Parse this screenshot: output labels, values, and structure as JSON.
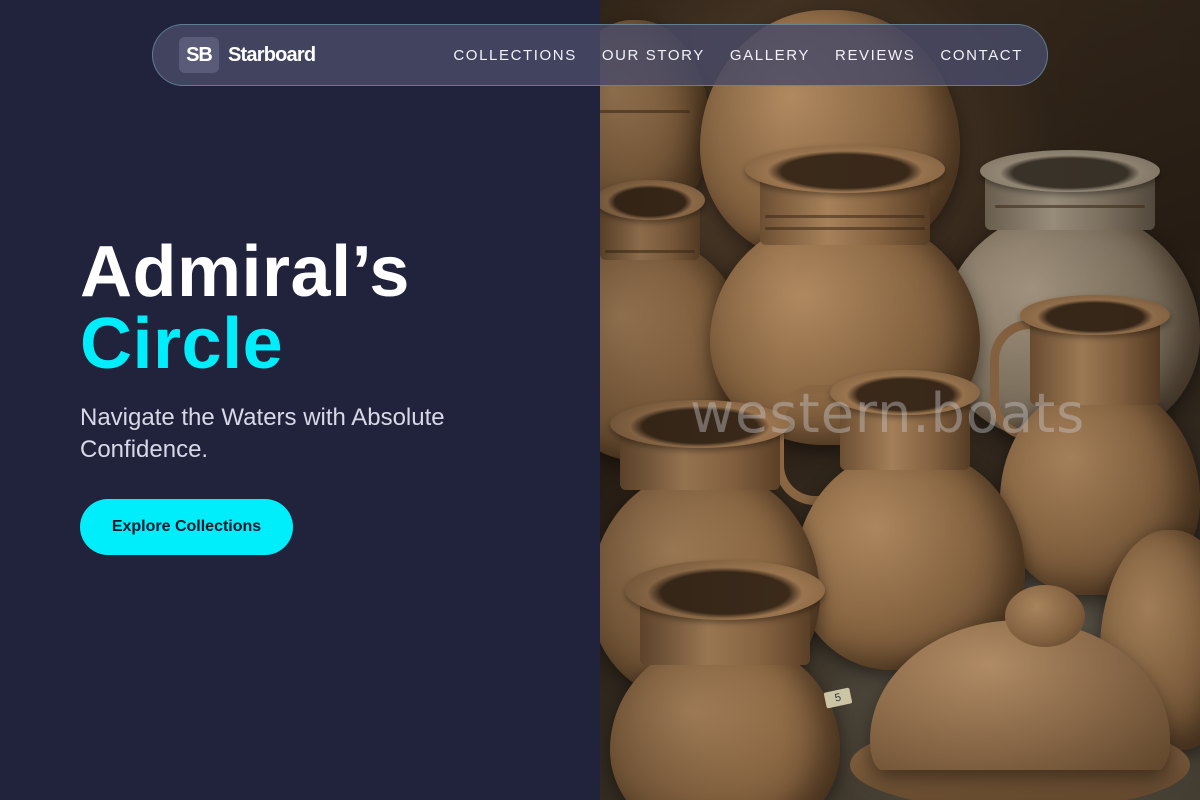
{
  "brand": {
    "mark": "SB",
    "name": "Starboard"
  },
  "nav": {
    "items": [
      {
        "label": "COLLECTIONS"
      },
      {
        "label": "OUR STORY"
      },
      {
        "label": "GALLERY"
      },
      {
        "label": "REVIEWS"
      },
      {
        "label": "CONTACT"
      }
    ]
  },
  "hero": {
    "title_line1": "Admiral’s",
    "title_line2": "Circle",
    "subtitle": "Navigate the Waters with Absolute Confidence.",
    "cta_label": "Explore Collections"
  },
  "image": {
    "watermark": "western.boats",
    "tag_label": "5"
  },
  "colors": {
    "background": "#21223b",
    "accent": "#00eefc",
    "nav_background": "#484a68",
    "nav_border": "#78afbe"
  }
}
